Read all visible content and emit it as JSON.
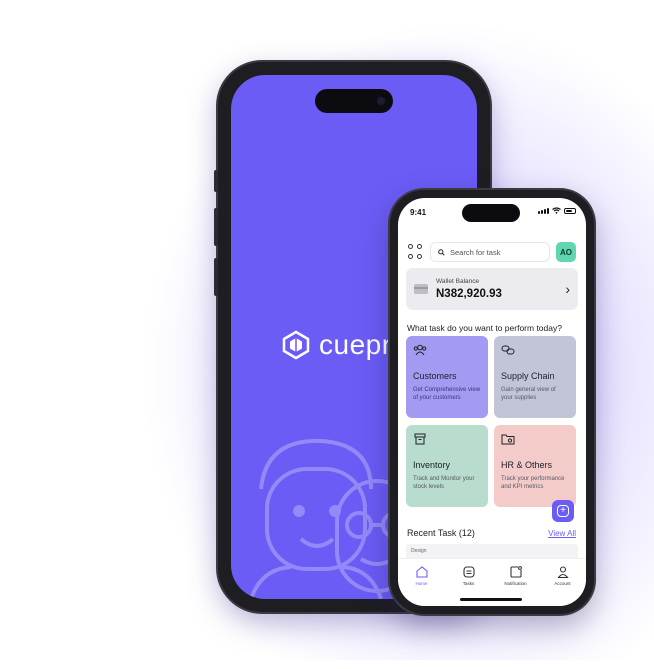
{
  "splash": {
    "brand": "cuepr"
  },
  "status": {
    "time": "9:41"
  },
  "search": {
    "placeholder": "Search for task"
  },
  "user": {
    "initials": "AO"
  },
  "wallet": {
    "label": "Wallet Balance",
    "amount": "N382,920.93"
  },
  "question": "What task do you want to perform today?",
  "cards": [
    {
      "title": "Customers",
      "desc": "Get Comprehensive view of your customers",
      "icon": "users-icon",
      "color": "#a39bf1"
    },
    {
      "title": "Supply Chain",
      "desc": "Gain general view of your supplies",
      "icon": "link-icon",
      "color": "#c2c4d8"
    },
    {
      "title": "Inventory",
      "desc": "Track and Monitor your stock levels",
      "icon": "archive-icon",
      "color": "#b8dccd"
    },
    {
      "title": "HR & Others",
      "desc": "Track your performance and KPI metrics",
      "icon": "folder-settings-icon",
      "color": "#f3cbc9"
    }
  ],
  "recent": {
    "title": "Recent Task (12)",
    "view_all": "View All",
    "first_tag": "Design"
  },
  "tabs": [
    {
      "label": "Home",
      "icon": "home-icon",
      "active": true
    },
    {
      "label": "Tasks",
      "icon": "tasks-icon"
    },
    {
      "label": "Notification",
      "icon": "notification-icon"
    },
    {
      "label": "Account",
      "icon": "account-icon"
    }
  ],
  "colors": {
    "accent": "#6a5cf5",
    "avatar": "#5fd6b0"
  }
}
